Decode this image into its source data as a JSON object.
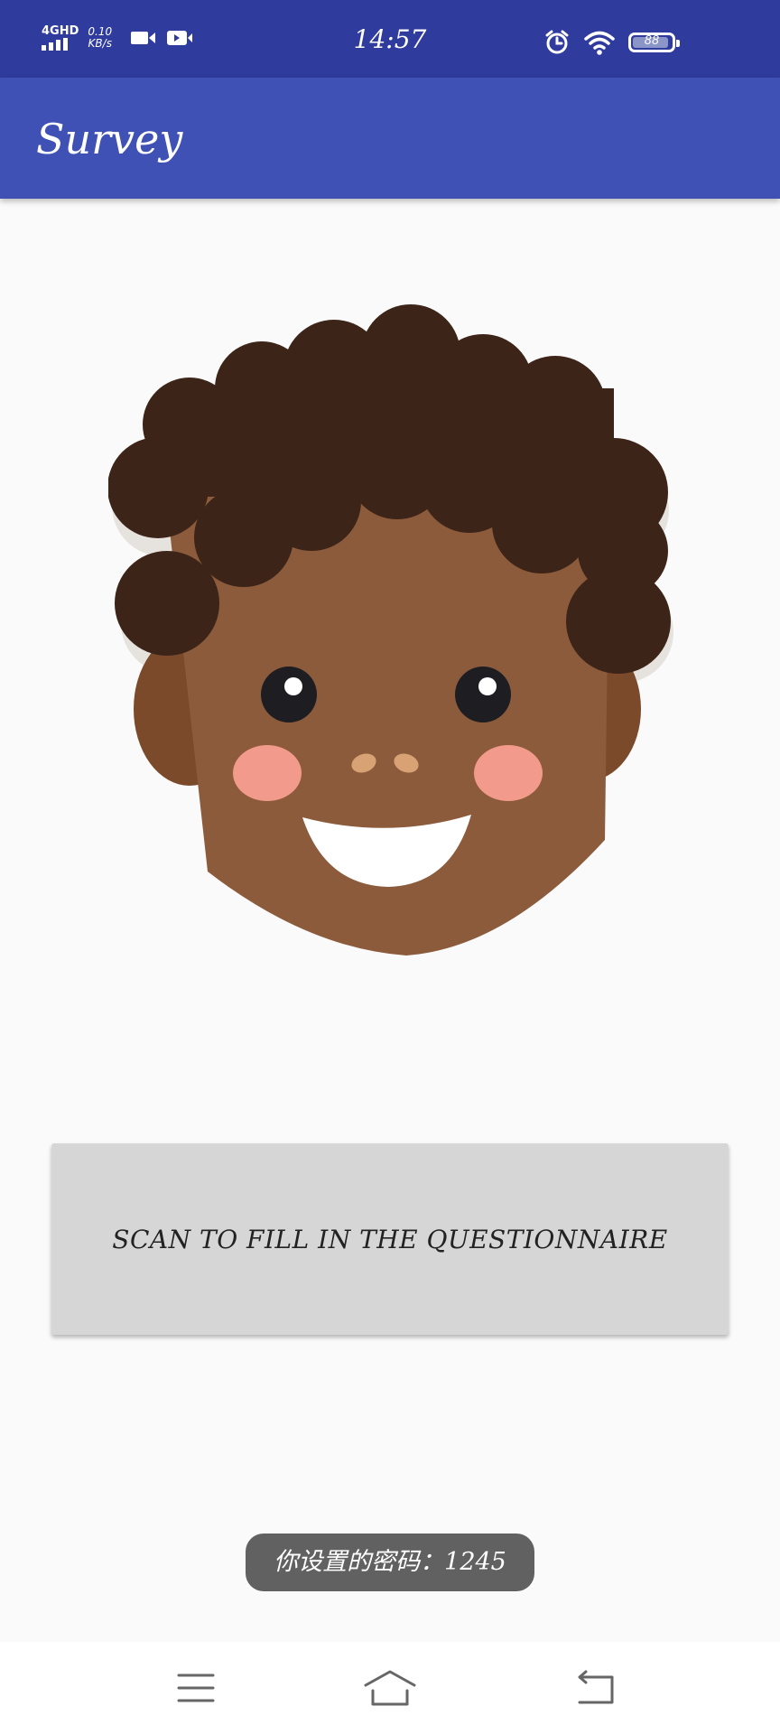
{
  "status_bar": {
    "network_type": "4GHD",
    "net_speed_value": "0.10",
    "net_speed_unit": "KB/s",
    "time": "14:57",
    "battery_level": "88",
    "icons": [
      "signal-icon",
      "video-camera-icon",
      "video-play-icon",
      "alarm-icon",
      "wifi-icon",
      "battery-icon"
    ]
  },
  "app_bar": {
    "title": "Survey"
  },
  "main": {
    "scan_button_label": "SCAN TO FILL IN THE QUESTIONNAIRE"
  },
  "toast": {
    "message": "你设置的密码：1245"
  },
  "nav_bar": {
    "icons": [
      "menu-icon",
      "home-icon",
      "back-icon"
    ]
  },
  "colors": {
    "status_bar": "#2f3c9e",
    "app_bar": "#3f51b5",
    "background": "#fafafa",
    "button": "#d6d6d6",
    "toast": "#616161"
  }
}
